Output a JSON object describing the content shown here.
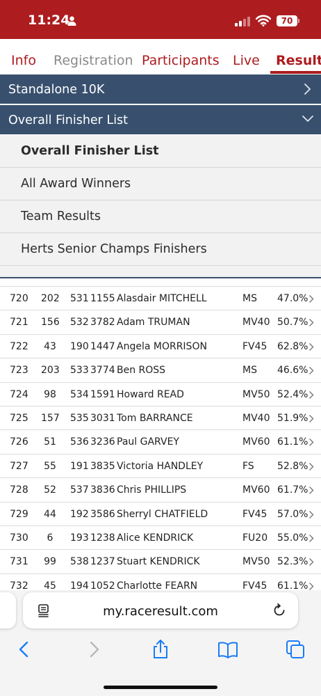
{
  "status_bar": {
    "time": "11:24",
    "battery": "70"
  },
  "tabs": [
    {
      "label": "Info",
      "state": "normal"
    },
    {
      "label": "Registration",
      "state": "muted"
    },
    {
      "label": "Participants",
      "state": "normal"
    },
    {
      "label": "Live",
      "state": "normal"
    },
    {
      "label": "Results",
      "state": "active"
    }
  ],
  "race_selector": {
    "label": "Standalone 10K"
  },
  "list_selector": {
    "label": "Overall Finisher List"
  },
  "dropdown": {
    "items": [
      "Overall Finisher List",
      "All Award Winners",
      "Team Results",
      "Herts Senior Champs Finishers"
    ]
  },
  "results": [
    {
      "rank": "720",
      "cat_pos": "202",
      "gender_pos": "531",
      "bib": "1155",
      "name": "Alasdair MITCHELL",
      "age_group": "MS",
      "age_grade": "47.0%"
    },
    {
      "rank": "721",
      "cat_pos": "156",
      "gender_pos": "532",
      "bib": "3782",
      "name": "Adam TRUMAN",
      "age_group": "MV40",
      "age_grade": "50.7%"
    },
    {
      "rank": "722",
      "cat_pos": "43",
      "gender_pos": "190",
      "bib": "1447",
      "name": "Angela MORRISON",
      "age_group": "FV45",
      "age_grade": "62.8%"
    },
    {
      "rank": "723",
      "cat_pos": "203",
      "gender_pos": "533",
      "bib": "3774",
      "name": "Ben ROSS",
      "age_group": "MS",
      "age_grade": "46.6%"
    },
    {
      "rank": "724",
      "cat_pos": "98",
      "gender_pos": "534",
      "bib": "1591",
      "name": "Howard READ",
      "age_group": "MV50",
      "age_grade": "52.4%"
    },
    {
      "rank": "725",
      "cat_pos": "157",
      "gender_pos": "535",
      "bib": "3031",
      "name": "Tom BARRANCE",
      "age_group": "MV40",
      "age_grade": "51.9%"
    },
    {
      "rank": "726",
      "cat_pos": "51",
      "gender_pos": "536",
      "bib": "3236",
      "name": "Paul GARVEY",
      "age_group": "MV60",
      "age_grade": "61.1%"
    },
    {
      "rank": "727",
      "cat_pos": "55",
      "gender_pos": "191",
      "bib": "3835",
      "name": "Victoria HANDLEY",
      "age_group": "FS",
      "age_grade": "52.8%"
    },
    {
      "rank": "728",
      "cat_pos": "52",
      "gender_pos": "537",
      "bib": "3836",
      "name": "Chris PHILLIPS",
      "age_group": "MV60",
      "age_grade": "61.7%"
    },
    {
      "rank": "729",
      "cat_pos": "44",
      "gender_pos": "192",
      "bib": "3586",
      "name": "Sherryl CHATFIELD",
      "age_group": "FV45",
      "age_grade": "57.0%"
    },
    {
      "rank": "730",
      "cat_pos": "6",
      "gender_pos": "193",
      "bib": "1238",
      "name": "Alice KENDRICK",
      "age_group": "FU20",
      "age_grade": "55.0%"
    },
    {
      "rank": "731",
      "cat_pos": "99",
      "gender_pos": "538",
      "bib": "1237",
      "name": "Stuart KENDRICK",
      "age_group": "MV50",
      "age_grade": "52.3%"
    },
    {
      "rank": "732",
      "cat_pos": "45",
      "gender_pos": "194",
      "bib": "1052",
      "name": "Charlotte FEARN",
      "age_group": "FV45",
      "age_grade": "61.1%"
    }
  ],
  "browser": {
    "url": "my.raceresult.com"
  },
  "icons": {
    "person": "person-icon",
    "signal": "cellular-signal-icon",
    "wifi": "wifi-icon",
    "chevron_right": "chevron-right-icon",
    "chevron_down": "chevron-down-icon",
    "page": "page-settings-icon",
    "reload": "reload-icon",
    "back": "back-icon",
    "forward": "forward-icon",
    "share": "share-icon",
    "bookmarks": "bookmarks-icon",
    "tabs": "tabs-icon"
  },
  "colors": {
    "brand_red": "#ad1c1f",
    "header_blue": "#38506e",
    "dropdown_bg": "#f2f2f2",
    "ios_blue": "#1a7cf5"
  }
}
